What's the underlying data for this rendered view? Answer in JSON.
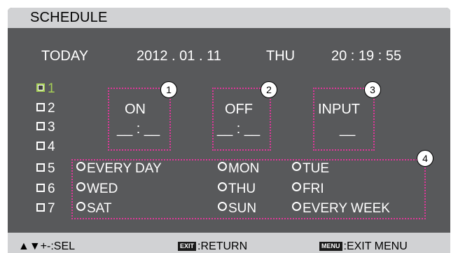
{
  "title": "SCHEDULE",
  "today": {
    "label": "TODAY",
    "date": "2012 . 01 . 11",
    "weekday": "THU",
    "time": "20 : 19 : 55"
  },
  "slots": [
    "1",
    "2",
    "3",
    "4",
    "5",
    "6",
    "7"
  ],
  "fields": {
    "on": {
      "label": "ON",
      "value": "__ : __",
      "callout": "1"
    },
    "off": {
      "label": "OFF",
      "value": "__ : __",
      "callout": "2"
    },
    "input": {
      "label": "INPUT",
      "value": "__",
      "callout": "3"
    }
  },
  "days_callout": "4",
  "days": [
    "EVERY DAY",
    "MON",
    "TUE",
    "WED",
    "THU",
    "FRI",
    "SAT",
    "SUN",
    "EVERY WEEK"
  ],
  "footer": {
    "select_symbols": "▲▼+-",
    "select_label": ":SEL",
    "exit_key": "EXIT",
    "exit_label": ":RETURN",
    "menu_key": "MENU",
    "menu_label": ":EXIT MENU"
  },
  "colors": {
    "panel": "#58595b",
    "bar": "#d1d2d4",
    "selected_text": "#a6cf56",
    "highlight_border": "#e0379a"
  }
}
